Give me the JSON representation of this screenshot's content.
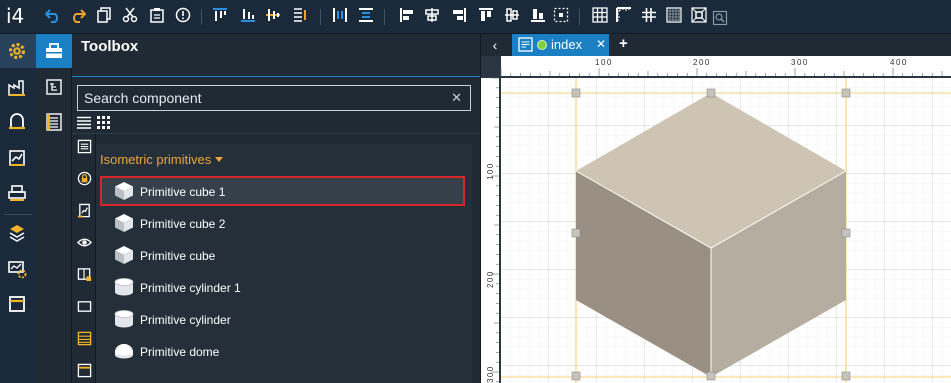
{
  "app": {
    "logo": "i4"
  },
  "toolbar": {
    "buttons": [
      {
        "name": "undo-button",
        "icon": "undo-icon"
      },
      {
        "name": "redo-button",
        "icon": "redo-icon"
      },
      {
        "name": "copy-button",
        "icon": "copy-icon"
      },
      {
        "name": "cut-button",
        "icon": "cut-icon"
      },
      {
        "name": "paste-button",
        "icon": "paste-icon"
      },
      {
        "name": "info-button",
        "icon": "info-icon"
      },
      {
        "name": "align-top-button",
        "icon": "align-top-icon"
      },
      {
        "name": "align-bottom-button",
        "icon": "align-bottom-icon"
      },
      {
        "name": "align-vertical-center-button",
        "icon": "align-vertical-center-icon"
      },
      {
        "name": "order-button",
        "icon": "order-icon"
      },
      {
        "name": "distribute-horizontal-button",
        "icon": "distribute-horizontal-icon"
      },
      {
        "name": "distribute-vertical-button",
        "icon": "distribute-vertical-icon"
      },
      {
        "name": "align-left-button",
        "icon": "align-left-icon"
      },
      {
        "name": "align-center-button",
        "icon": "align-center-icon"
      },
      {
        "name": "align-right-button",
        "icon": "align-right-icon"
      },
      {
        "name": "align-top-edge-button",
        "icon": "align-top-edge-icon"
      },
      {
        "name": "align-middle-button",
        "icon": "align-middle-icon"
      },
      {
        "name": "align-bottom-edge-button",
        "icon": "align-bottom-edge-icon"
      },
      {
        "name": "center-button",
        "icon": "center-icon"
      },
      {
        "name": "grid-button",
        "icon": "grid-icon"
      },
      {
        "name": "ruler-button",
        "icon": "ruler-icon"
      },
      {
        "name": "snap-grid-button",
        "icon": "snap-grid-icon"
      },
      {
        "name": "fine-grid-button",
        "icon": "fine-grid-icon"
      },
      {
        "name": "snap-objects-button",
        "icon": "snap-objects-icon"
      },
      {
        "name": "zoom-fit-button",
        "icon": "zoom-fit-icon"
      }
    ]
  },
  "leftnav": {
    "items": [
      {
        "name": "settings-nav-item",
        "icon": "gear-icon"
      },
      {
        "name": "factory-nav-item",
        "icon": "factory-icon"
      },
      {
        "name": "hmi-nav-item",
        "icon": "hmi-icon"
      },
      {
        "name": "trend-nav-item",
        "icon": "trend-icon"
      },
      {
        "name": "printer-nav-item",
        "icon": "printer-icon"
      },
      {
        "name": "deploy-nav-item",
        "icon": "deploy-icon"
      },
      {
        "name": "monitor-settings-nav-item",
        "icon": "monitor-settings-icon"
      },
      {
        "name": "window-nav-item",
        "icon": "window-icon"
      }
    ]
  },
  "toolbox": {
    "title": "Toolbox",
    "search_placeholder": "Search component",
    "clear_label": "✕",
    "group_header": "Isometric primitives",
    "items": [
      {
        "label": "Primitive cube 1",
        "icon": "cube-icon",
        "selected": true
      },
      {
        "label": "Primitive cube 2",
        "icon": "cube-icon"
      },
      {
        "label": "Primitive cube",
        "icon": "cube-icon"
      },
      {
        "label": "Primitive cylinder 1",
        "icon": "cylinder-icon"
      },
      {
        "label": "Primitive cylinder",
        "icon": "cylinder-icon"
      },
      {
        "label": "Primitive dome",
        "icon": "dome-icon"
      }
    ]
  },
  "tabs": {
    "back_label": "‹",
    "index": {
      "label": "index",
      "close_label": "✕",
      "status_color": "#7fd23a"
    },
    "add_label": "+"
  },
  "canvas": {
    "ruler_labels_x": [
      "100",
      "200",
      "300",
      "400"
    ],
    "ruler_labels_y": [
      "100",
      "200",
      "300"
    ],
    "cube_colors": {
      "top": "#cdc4b4",
      "left": "#998f82",
      "right": "#b5ad9f"
    }
  }
}
